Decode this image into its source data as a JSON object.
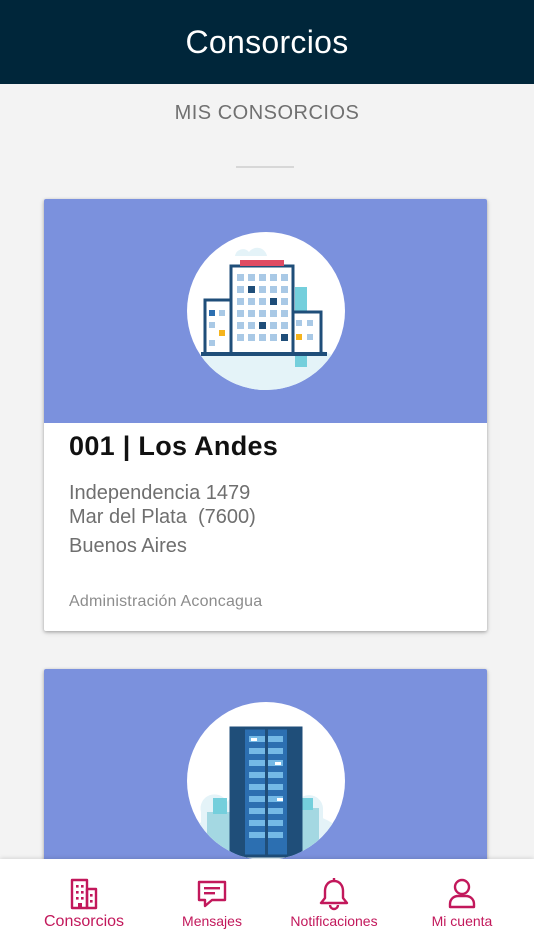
{
  "header": {
    "title": "Consorcios"
  },
  "section": {
    "title": "MIS CONSORCIOS"
  },
  "consorcios": [
    {
      "name": "001 | Los Andes",
      "address_line_1": "Independencia 1479",
      "address_line_2": "Mar del Plata  (7600)",
      "address_line_3": "Buenos Aires",
      "administration": "Administración Aconcagua"
    }
  ],
  "bottom_nav": {
    "items": [
      {
        "label": "Consorcios",
        "icon": "building-icon",
        "active": true
      },
      {
        "label": "Mensajes",
        "icon": "message-icon",
        "active": false
      },
      {
        "label": "Notificaciones",
        "icon": "bell-icon",
        "active": false
      },
      {
        "label": "Mi cuenta",
        "icon": "user-icon",
        "active": false
      }
    ]
  },
  "colors": {
    "header_bg": "#00263a",
    "card_banner": "#7b91dd",
    "accent": "#c2185b",
    "page_bg": "#f3f3f3"
  }
}
